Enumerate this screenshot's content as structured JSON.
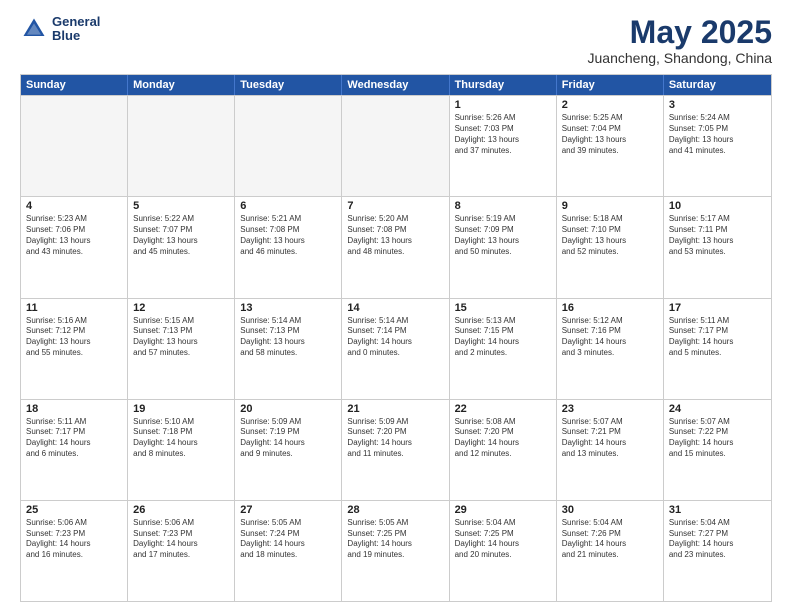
{
  "header": {
    "logo_line1": "General",
    "logo_line2": "Blue",
    "month": "May 2025",
    "location": "Juancheng, Shandong, China"
  },
  "days_of_week": [
    "Sunday",
    "Monday",
    "Tuesday",
    "Wednesday",
    "Thursday",
    "Friday",
    "Saturday"
  ],
  "rows": [
    [
      {
        "day": "",
        "text": "",
        "empty": true
      },
      {
        "day": "",
        "text": "",
        "empty": true
      },
      {
        "day": "",
        "text": "",
        "empty": true
      },
      {
        "day": "",
        "text": "",
        "empty": true
      },
      {
        "day": "1",
        "text": "Sunrise: 5:26 AM\nSunset: 7:03 PM\nDaylight: 13 hours\nand 37 minutes.",
        "empty": false
      },
      {
        "day": "2",
        "text": "Sunrise: 5:25 AM\nSunset: 7:04 PM\nDaylight: 13 hours\nand 39 minutes.",
        "empty": false
      },
      {
        "day": "3",
        "text": "Sunrise: 5:24 AM\nSunset: 7:05 PM\nDaylight: 13 hours\nand 41 minutes.",
        "empty": false
      }
    ],
    [
      {
        "day": "4",
        "text": "Sunrise: 5:23 AM\nSunset: 7:06 PM\nDaylight: 13 hours\nand 43 minutes.",
        "empty": false
      },
      {
        "day": "5",
        "text": "Sunrise: 5:22 AM\nSunset: 7:07 PM\nDaylight: 13 hours\nand 45 minutes.",
        "empty": false
      },
      {
        "day": "6",
        "text": "Sunrise: 5:21 AM\nSunset: 7:08 PM\nDaylight: 13 hours\nand 46 minutes.",
        "empty": false
      },
      {
        "day": "7",
        "text": "Sunrise: 5:20 AM\nSunset: 7:08 PM\nDaylight: 13 hours\nand 48 minutes.",
        "empty": false
      },
      {
        "day": "8",
        "text": "Sunrise: 5:19 AM\nSunset: 7:09 PM\nDaylight: 13 hours\nand 50 minutes.",
        "empty": false
      },
      {
        "day": "9",
        "text": "Sunrise: 5:18 AM\nSunset: 7:10 PM\nDaylight: 13 hours\nand 52 minutes.",
        "empty": false
      },
      {
        "day": "10",
        "text": "Sunrise: 5:17 AM\nSunset: 7:11 PM\nDaylight: 13 hours\nand 53 minutes.",
        "empty": false
      }
    ],
    [
      {
        "day": "11",
        "text": "Sunrise: 5:16 AM\nSunset: 7:12 PM\nDaylight: 13 hours\nand 55 minutes.",
        "empty": false
      },
      {
        "day": "12",
        "text": "Sunrise: 5:15 AM\nSunset: 7:13 PM\nDaylight: 13 hours\nand 57 minutes.",
        "empty": false
      },
      {
        "day": "13",
        "text": "Sunrise: 5:14 AM\nSunset: 7:13 PM\nDaylight: 13 hours\nand 58 minutes.",
        "empty": false
      },
      {
        "day": "14",
        "text": "Sunrise: 5:14 AM\nSunset: 7:14 PM\nDaylight: 14 hours\nand 0 minutes.",
        "empty": false
      },
      {
        "day": "15",
        "text": "Sunrise: 5:13 AM\nSunset: 7:15 PM\nDaylight: 14 hours\nand 2 minutes.",
        "empty": false
      },
      {
        "day": "16",
        "text": "Sunrise: 5:12 AM\nSunset: 7:16 PM\nDaylight: 14 hours\nand 3 minutes.",
        "empty": false
      },
      {
        "day": "17",
        "text": "Sunrise: 5:11 AM\nSunset: 7:17 PM\nDaylight: 14 hours\nand 5 minutes.",
        "empty": false
      }
    ],
    [
      {
        "day": "18",
        "text": "Sunrise: 5:11 AM\nSunset: 7:17 PM\nDaylight: 14 hours\nand 6 minutes.",
        "empty": false
      },
      {
        "day": "19",
        "text": "Sunrise: 5:10 AM\nSunset: 7:18 PM\nDaylight: 14 hours\nand 8 minutes.",
        "empty": false
      },
      {
        "day": "20",
        "text": "Sunrise: 5:09 AM\nSunset: 7:19 PM\nDaylight: 14 hours\nand 9 minutes.",
        "empty": false
      },
      {
        "day": "21",
        "text": "Sunrise: 5:09 AM\nSunset: 7:20 PM\nDaylight: 14 hours\nand 11 minutes.",
        "empty": false
      },
      {
        "day": "22",
        "text": "Sunrise: 5:08 AM\nSunset: 7:20 PM\nDaylight: 14 hours\nand 12 minutes.",
        "empty": false
      },
      {
        "day": "23",
        "text": "Sunrise: 5:07 AM\nSunset: 7:21 PM\nDaylight: 14 hours\nand 13 minutes.",
        "empty": false
      },
      {
        "day": "24",
        "text": "Sunrise: 5:07 AM\nSunset: 7:22 PM\nDaylight: 14 hours\nand 15 minutes.",
        "empty": false
      }
    ],
    [
      {
        "day": "25",
        "text": "Sunrise: 5:06 AM\nSunset: 7:23 PM\nDaylight: 14 hours\nand 16 minutes.",
        "empty": false
      },
      {
        "day": "26",
        "text": "Sunrise: 5:06 AM\nSunset: 7:23 PM\nDaylight: 14 hours\nand 17 minutes.",
        "empty": false
      },
      {
        "day": "27",
        "text": "Sunrise: 5:05 AM\nSunset: 7:24 PM\nDaylight: 14 hours\nand 18 minutes.",
        "empty": false
      },
      {
        "day": "28",
        "text": "Sunrise: 5:05 AM\nSunset: 7:25 PM\nDaylight: 14 hours\nand 19 minutes.",
        "empty": false
      },
      {
        "day": "29",
        "text": "Sunrise: 5:04 AM\nSunset: 7:25 PM\nDaylight: 14 hours\nand 20 minutes.",
        "empty": false
      },
      {
        "day": "30",
        "text": "Sunrise: 5:04 AM\nSunset: 7:26 PM\nDaylight: 14 hours\nand 21 minutes.",
        "empty": false
      },
      {
        "day": "31",
        "text": "Sunrise: 5:04 AM\nSunset: 7:27 PM\nDaylight: 14 hours\nand 23 minutes.",
        "empty": false
      }
    ]
  ]
}
